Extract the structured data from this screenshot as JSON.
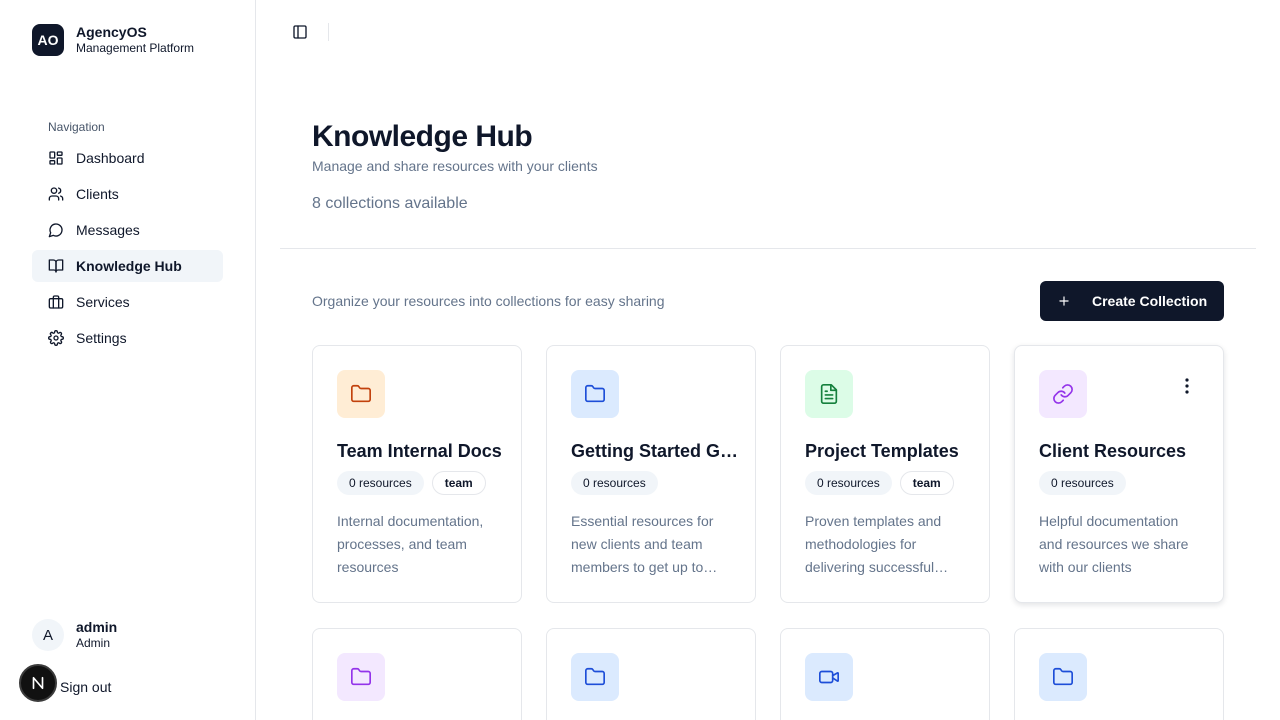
{
  "brand": {
    "logo": "AO",
    "name": "AgencyOS",
    "subtitle": "Management Platform"
  },
  "sidebar": {
    "section_label": "Navigation",
    "items": [
      {
        "label": "Dashboard",
        "icon": "layout-dashboard-icon"
      },
      {
        "label": "Clients",
        "icon": "users-icon"
      },
      {
        "label": "Messages",
        "icon": "message-circle-icon"
      },
      {
        "label": "Knowledge Hub",
        "icon": "book-open-icon",
        "active": true
      },
      {
        "label": "Services",
        "icon": "briefcase-icon"
      },
      {
        "label": "Settings",
        "icon": "gear-icon"
      }
    ]
  },
  "user": {
    "initial": "A",
    "name": "admin",
    "role": "Admin"
  },
  "signout_label": "Sign out",
  "page": {
    "title": "Knowledge Hub",
    "subtitle": "Manage and share resources with your clients",
    "count_text": "8 collections available"
  },
  "toolbar": {
    "hint": "Organize your resources into collections for easy sharing",
    "create_label": "Create Collection"
  },
  "colors": {
    "primary": "#0f172a",
    "muted_text": "#64748b",
    "border": "#e5e7eb",
    "orange_bg": "#ffedd5",
    "orange_fg": "#c2410c",
    "blue_bg": "#dbeafe",
    "blue_fg": "#1d4ed8",
    "green_bg": "#dcfce7",
    "green_fg": "#15803d",
    "purple_bg": "#f3e8ff",
    "purple_fg": "#9333ea"
  },
  "collections": [
    {
      "title": "Team Internal Docs",
      "resources": "0 resources",
      "tag": "team",
      "description": "Internal documentation, processes, and team resources",
      "icon": "folder-icon",
      "color": "orange"
    },
    {
      "title": "Getting Started Guide",
      "resources": "0 resources",
      "tag": "",
      "description": "Essential resources for new clients and team members to get up to speed",
      "icon": "folder-icon",
      "color": "blue"
    },
    {
      "title": "Project Templates",
      "resources": "0 resources",
      "tag": "team",
      "description": "Proven templates and methodologies for delivering successful projects",
      "icon": "file-text-icon",
      "color": "green"
    },
    {
      "title": "Client Resources",
      "resources": "0 resources",
      "tag": "",
      "description": "Helpful documentation and resources we share with our clients",
      "icon": "link-icon",
      "color": "purple"
    },
    {
      "title": "",
      "resources": "",
      "tag": "",
      "description": "",
      "icon": "folder-icon",
      "color": "purple"
    },
    {
      "title": "",
      "resources": "",
      "tag": "",
      "description": "",
      "icon": "folder-icon",
      "color": "blue"
    },
    {
      "title": "",
      "resources": "",
      "tag": "",
      "description": "",
      "icon": "video-icon",
      "color": "blue"
    },
    {
      "title": "",
      "resources": "",
      "tag": "",
      "description": "",
      "icon": "folder-icon",
      "color": "blue"
    }
  ]
}
